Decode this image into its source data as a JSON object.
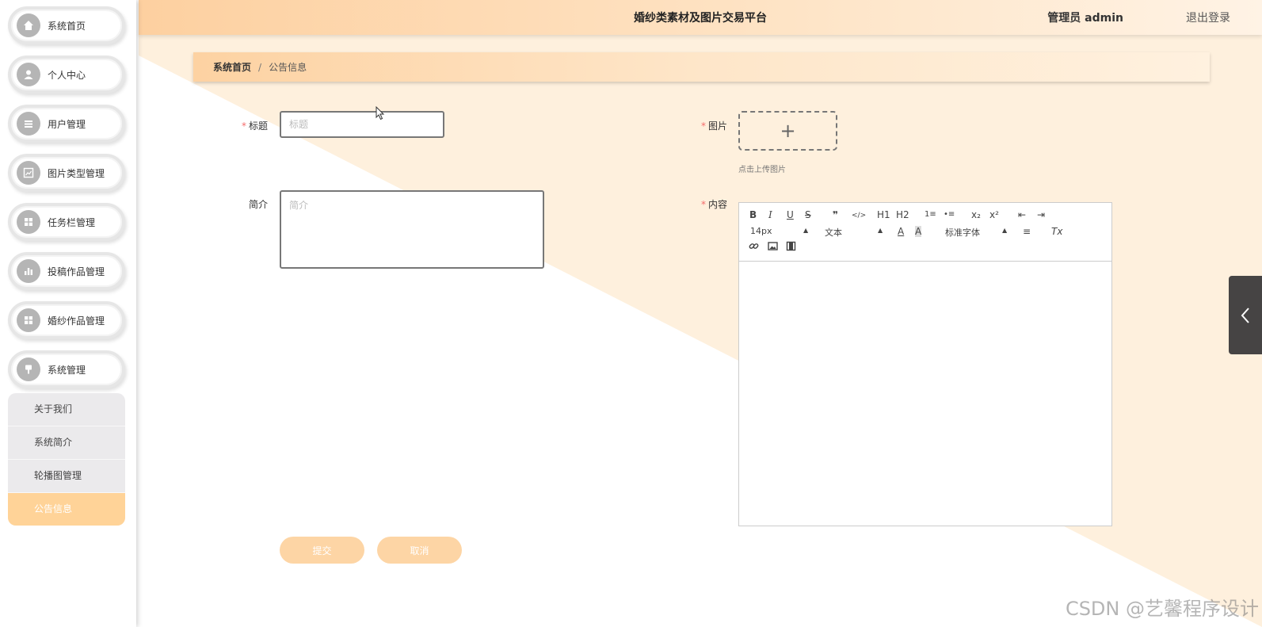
{
  "header": {
    "site_title": "婚纱类素材及图片交易平台",
    "admin_info": "管理员 admin",
    "logout": "退出登录"
  },
  "sidebar": {
    "items": [
      {
        "label": "系统首页",
        "icon": "home-icon"
      },
      {
        "label": "个人中心",
        "icon": "user-icon"
      },
      {
        "label": "用户管理",
        "icon": "list-icon"
      },
      {
        "label": "图片类型管理",
        "icon": "chart-icon"
      },
      {
        "label": "任务栏管理",
        "icon": "grid-icon"
      },
      {
        "label": "投稿作品管理",
        "icon": "bar-chart-icon"
      },
      {
        "label": "婚纱作品管理",
        "icon": "grid-icon"
      },
      {
        "label": "系统管理",
        "icon": "pin-icon"
      }
    ],
    "submenu": [
      "关于我们",
      "系统简介",
      "轮播图管理",
      "公告信息"
    ],
    "active_submenu": "公告信息"
  },
  "breadcrumb": {
    "home": "系统首页",
    "separator": "/",
    "current": "公告信息"
  },
  "form": {
    "title_label": "标题",
    "title_placeholder": "标题",
    "title_value": "",
    "image_label": "图片",
    "upload_plus": "+",
    "upload_tip": "点击上传图片",
    "summary_label": "简介",
    "summary_placeholder": "简介",
    "content_label": "内容",
    "required_mark": "*"
  },
  "editor": {
    "font_size": "14px",
    "header_select": "文本",
    "font_family": "标准字体",
    "tools": {
      "bold": "B",
      "italic": "I",
      "underline": "U",
      "strike": "S",
      "quote": "❞",
      "code": "</>",
      "h1": "H1",
      "h2": "H2",
      "ordered_list": "1≡",
      "bullet_list": "•≡",
      "subscript": "x₂",
      "superscript": "x²",
      "outdent": "⇤",
      "indent": "⇥",
      "color": "A",
      "background": "A",
      "align": "≡",
      "clean": "Tx",
      "link": "🔗",
      "image": "🖼",
      "video": "🎞"
    }
  },
  "buttons": {
    "submit": "提交",
    "cancel": "取消"
  },
  "watermark": "CSDN @艺馨程序设计",
  "colors": {
    "accent": "#fdd5a5",
    "header_start": "#fdd0a0",
    "active_submenu": "#ffd398",
    "handle": "#464444"
  }
}
